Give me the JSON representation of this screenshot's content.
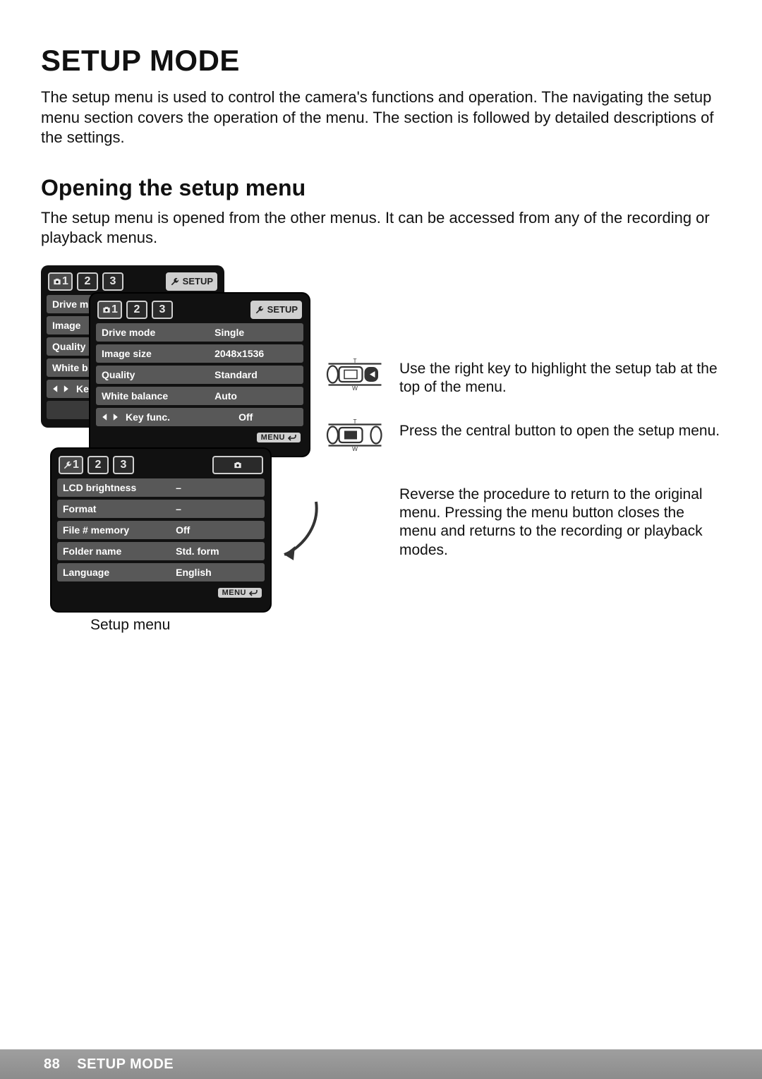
{
  "page": {
    "number": "88",
    "footer_title": "SETUP MODE",
    "title": "SETUP MODE",
    "intro": "The setup menu is used to control the camera's functions and operation. The navigating the setup menu section covers the operation of the menu. The section is followed by detailed descriptions of the settings.",
    "subtitle": "Opening the setup menu",
    "subintro": "The setup menu is opened from the other menus. It can be accessed from any of the recording or playback menus."
  },
  "instructions": {
    "step1": "Use the right key to highlight the setup tab at the top of the menu.",
    "step2": "Press the central button to open the setup menu.",
    "step3": "Reverse the procedure to return to the original menu. Pressing the menu button closes the menu and returns to the recording or playback modes."
  },
  "screens": {
    "rec_partial": {
      "tabs": {
        "t1": "1",
        "t2": "2",
        "t3": "3",
        "setup": "SETUP"
      },
      "rows": [
        "Drive m",
        "Image",
        "Quality",
        "White b",
        "Key"
      ]
    },
    "rec_full": {
      "tabs": {
        "t1": "1",
        "t2": "2",
        "t3": "3",
        "setup": "SETUP"
      },
      "rows": [
        {
          "label": "Drive mode",
          "value": "Single"
        },
        {
          "label": "Image size",
          "value": "2048x1536"
        },
        {
          "label": "Quality",
          "value": "Standard"
        },
        {
          "label": "White balance",
          "value": "Auto"
        },
        {
          "label": "Key func.",
          "value": "Off"
        }
      ],
      "footer": "MENU"
    },
    "setup": {
      "tabs": {
        "t1": "1",
        "t2": "2",
        "t3": "3"
      },
      "rows": [
        {
          "label": "LCD brightness",
          "value": "–"
        },
        {
          "label": "Format",
          "value": "–"
        },
        {
          "label": "File # memory",
          "value": "Off"
        },
        {
          "label": "Folder name",
          "value": "Std. form"
        },
        {
          "label": "Language",
          "value": "English"
        }
      ],
      "footer": "MENU",
      "caption": "Setup menu"
    }
  }
}
